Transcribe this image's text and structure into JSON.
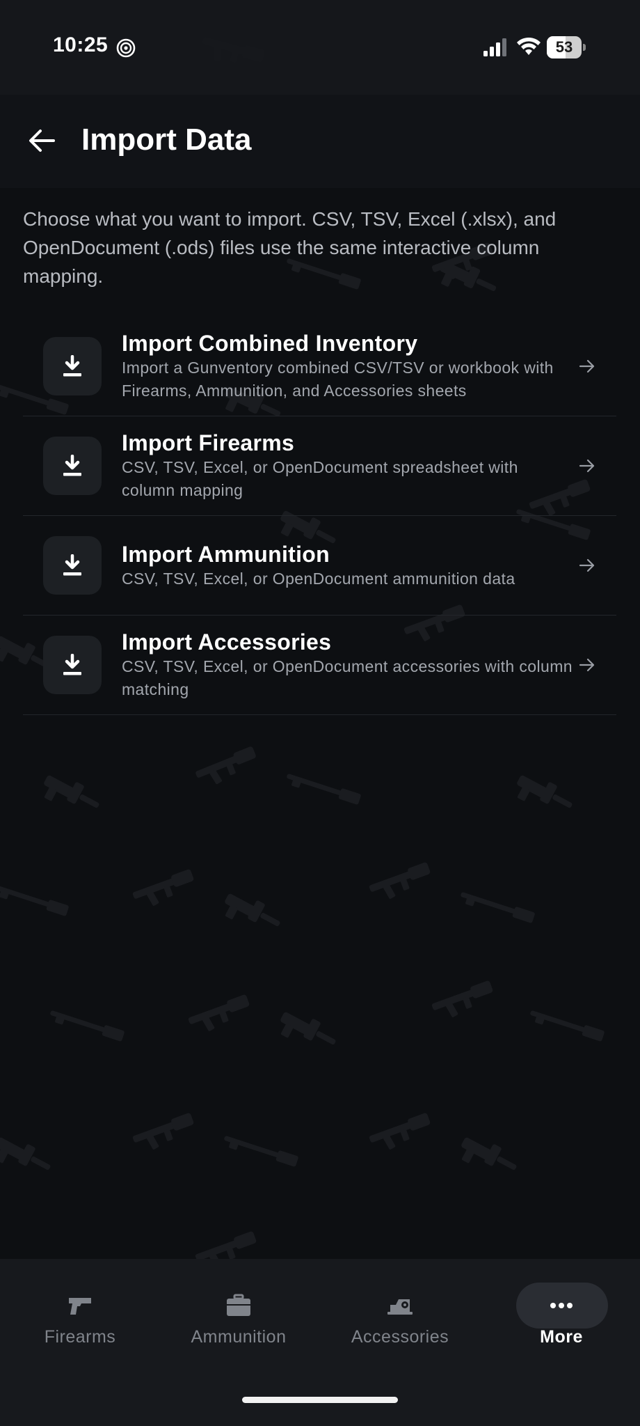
{
  "status_bar": {
    "time": "10:25",
    "battery_level": "53",
    "icons": [
      "focus-icon",
      "cellular-signal-icon",
      "wifi-icon",
      "battery-icon"
    ]
  },
  "header": {
    "title": "Import Data",
    "back_icon": "arrow-left-icon"
  },
  "intro_text": "Choose what you want to import. CSV, TSV, Excel (.xlsx), and OpenDocument (.ods) files use the same interactive column mapping.",
  "import_options": [
    {
      "title": "Import Combined Inventory",
      "description": "Import a Gunventory combined CSV/TSV or workbook with Firearms, Ammunition, and Accessories sheets",
      "icon": "download-icon"
    },
    {
      "title": "Import Firearms",
      "description": "CSV, TSV, Excel, or OpenDocument spreadsheet with column mapping",
      "icon": "download-icon"
    },
    {
      "title": "Import Ammunition",
      "description": "CSV, TSV, Excel, or OpenDocument ammunition data",
      "icon": "download-icon"
    },
    {
      "title": "Import Accessories",
      "description": "CSV, TSV, Excel, or OpenDocument accessories with column matching",
      "icon": "download-icon"
    }
  ],
  "tab_bar": {
    "active": "More",
    "tabs": [
      {
        "label": "Firearms",
        "icon": "pistol-icon"
      },
      {
        "label": "Ammunition",
        "icon": "ammo-box-icon"
      },
      {
        "label": "Accessories",
        "icon": "red-dot-sight-icon"
      },
      {
        "label": "More",
        "icon": "more-dots-icon"
      }
    ]
  },
  "colors": {
    "background": "#0d0f12",
    "surface": "#17191d",
    "tile": "#1d2024",
    "text_primary": "#ffffff",
    "text_secondary": "#a3a7ae",
    "tab_inactive": "#80848b"
  }
}
